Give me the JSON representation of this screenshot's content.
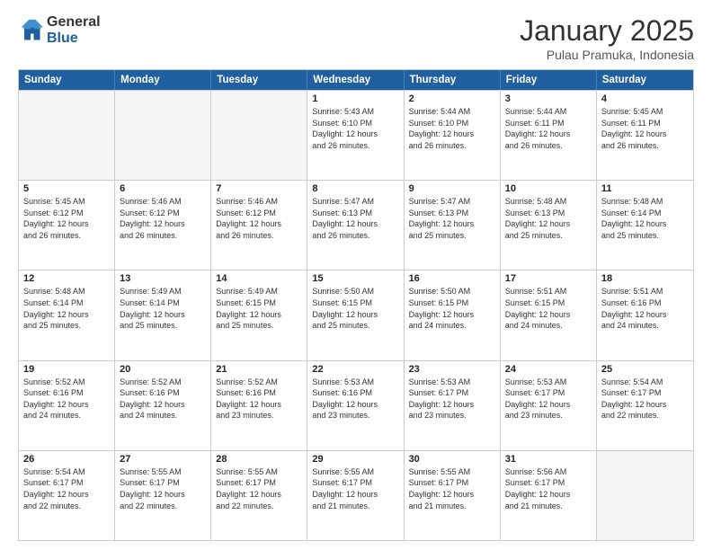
{
  "logo": {
    "line1": "General",
    "line2": "Blue"
  },
  "title": "January 2025",
  "subtitle": "Pulau Pramuka, Indonesia",
  "header": {
    "days": [
      "Sunday",
      "Monday",
      "Tuesday",
      "Wednesday",
      "Thursday",
      "Friday",
      "Saturday"
    ]
  },
  "weeks": [
    [
      {
        "day": "",
        "info": ""
      },
      {
        "day": "",
        "info": ""
      },
      {
        "day": "",
        "info": ""
      },
      {
        "day": "1",
        "info": "Sunrise: 5:43 AM\nSunset: 6:10 PM\nDaylight: 12 hours\nand 26 minutes."
      },
      {
        "day": "2",
        "info": "Sunrise: 5:44 AM\nSunset: 6:10 PM\nDaylight: 12 hours\nand 26 minutes."
      },
      {
        "day": "3",
        "info": "Sunrise: 5:44 AM\nSunset: 6:11 PM\nDaylight: 12 hours\nand 26 minutes."
      },
      {
        "day": "4",
        "info": "Sunrise: 5:45 AM\nSunset: 6:11 PM\nDaylight: 12 hours\nand 26 minutes."
      }
    ],
    [
      {
        "day": "5",
        "info": "Sunrise: 5:45 AM\nSunset: 6:12 PM\nDaylight: 12 hours\nand 26 minutes."
      },
      {
        "day": "6",
        "info": "Sunrise: 5:46 AM\nSunset: 6:12 PM\nDaylight: 12 hours\nand 26 minutes."
      },
      {
        "day": "7",
        "info": "Sunrise: 5:46 AM\nSunset: 6:12 PM\nDaylight: 12 hours\nand 26 minutes."
      },
      {
        "day": "8",
        "info": "Sunrise: 5:47 AM\nSunset: 6:13 PM\nDaylight: 12 hours\nand 26 minutes."
      },
      {
        "day": "9",
        "info": "Sunrise: 5:47 AM\nSunset: 6:13 PM\nDaylight: 12 hours\nand 25 minutes."
      },
      {
        "day": "10",
        "info": "Sunrise: 5:48 AM\nSunset: 6:13 PM\nDaylight: 12 hours\nand 25 minutes."
      },
      {
        "day": "11",
        "info": "Sunrise: 5:48 AM\nSunset: 6:14 PM\nDaylight: 12 hours\nand 25 minutes."
      }
    ],
    [
      {
        "day": "12",
        "info": "Sunrise: 5:48 AM\nSunset: 6:14 PM\nDaylight: 12 hours\nand 25 minutes."
      },
      {
        "day": "13",
        "info": "Sunrise: 5:49 AM\nSunset: 6:14 PM\nDaylight: 12 hours\nand 25 minutes."
      },
      {
        "day": "14",
        "info": "Sunrise: 5:49 AM\nSunset: 6:15 PM\nDaylight: 12 hours\nand 25 minutes."
      },
      {
        "day": "15",
        "info": "Sunrise: 5:50 AM\nSunset: 6:15 PM\nDaylight: 12 hours\nand 25 minutes."
      },
      {
        "day": "16",
        "info": "Sunrise: 5:50 AM\nSunset: 6:15 PM\nDaylight: 12 hours\nand 24 minutes."
      },
      {
        "day": "17",
        "info": "Sunrise: 5:51 AM\nSunset: 6:15 PM\nDaylight: 12 hours\nand 24 minutes."
      },
      {
        "day": "18",
        "info": "Sunrise: 5:51 AM\nSunset: 6:16 PM\nDaylight: 12 hours\nand 24 minutes."
      }
    ],
    [
      {
        "day": "19",
        "info": "Sunrise: 5:52 AM\nSunset: 6:16 PM\nDaylight: 12 hours\nand 24 minutes."
      },
      {
        "day": "20",
        "info": "Sunrise: 5:52 AM\nSunset: 6:16 PM\nDaylight: 12 hours\nand 24 minutes."
      },
      {
        "day": "21",
        "info": "Sunrise: 5:52 AM\nSunset: 6:16 PM\nDaylight: 12 hours\nand 23 minutes."
      },
      {
        "day": "22",
        "info": "Sunrise: 5:53 AM\nSunset: 6:16 PM\nDaylight: 12 hours\nand 23 minutes."
      },
      {
        "day": "23",
        "info": "Sunrise: 5:53 AM\nSunset: 6:17 PM\nDaylight: 12 hours\nand 23 minutes."
      },
      {
        "day": "24",
        "info": "Sunrise: 5:53 AM\nSunset: 6:17 PM\nDaylight: 12 hours\nand 23 minutes."
      },
      {
        "day": "25",
        "info": "Sunrise: 5:54 AM\nSunset: 6:17 PM\nDaylight: 12 hours\nand 22 minutes."
      }
    ],
    [
      {
        "day": "26",
        "info": "Sunrise: 5:54 AM\nSunset: 6:17 PM\nDaylight: 12 hours\nand 22 minutes."
      },
      {
        "day": "27",
        "info": "Sunrise: 5:55 AM\nSunset: 6:17 PM\nDaylight: 12 hours\nand 22 minutes."
      },
      {
        "day": "28",
        "info": "Sunrise: 5:55 AM\nSunset: 6:17 PM\nDaylight: 12 hours\nand 22 minutes."
      },
      {
        "day": "29",
        "info": "Sunrise: 5:55 AM\nSunset: 6:17 PM\nDaylight: 12 hours\nand 21 minutes."
      },
      {
        "day": "30",
        "info": "Sunrise: 5:55 AM\nSunset: 6:17 PM\nDaylight: 12 hours\nand 21 minutes."
      },
      {
        "day": "31",
        "info": "Sunrise: 5:56 AM\nSunset: 6:17 PM\nDaylight: 12 hours\nand 21 minutes."
      },
      {
        "day": "",
        "info": ""
      }
    ]
  ]
}
